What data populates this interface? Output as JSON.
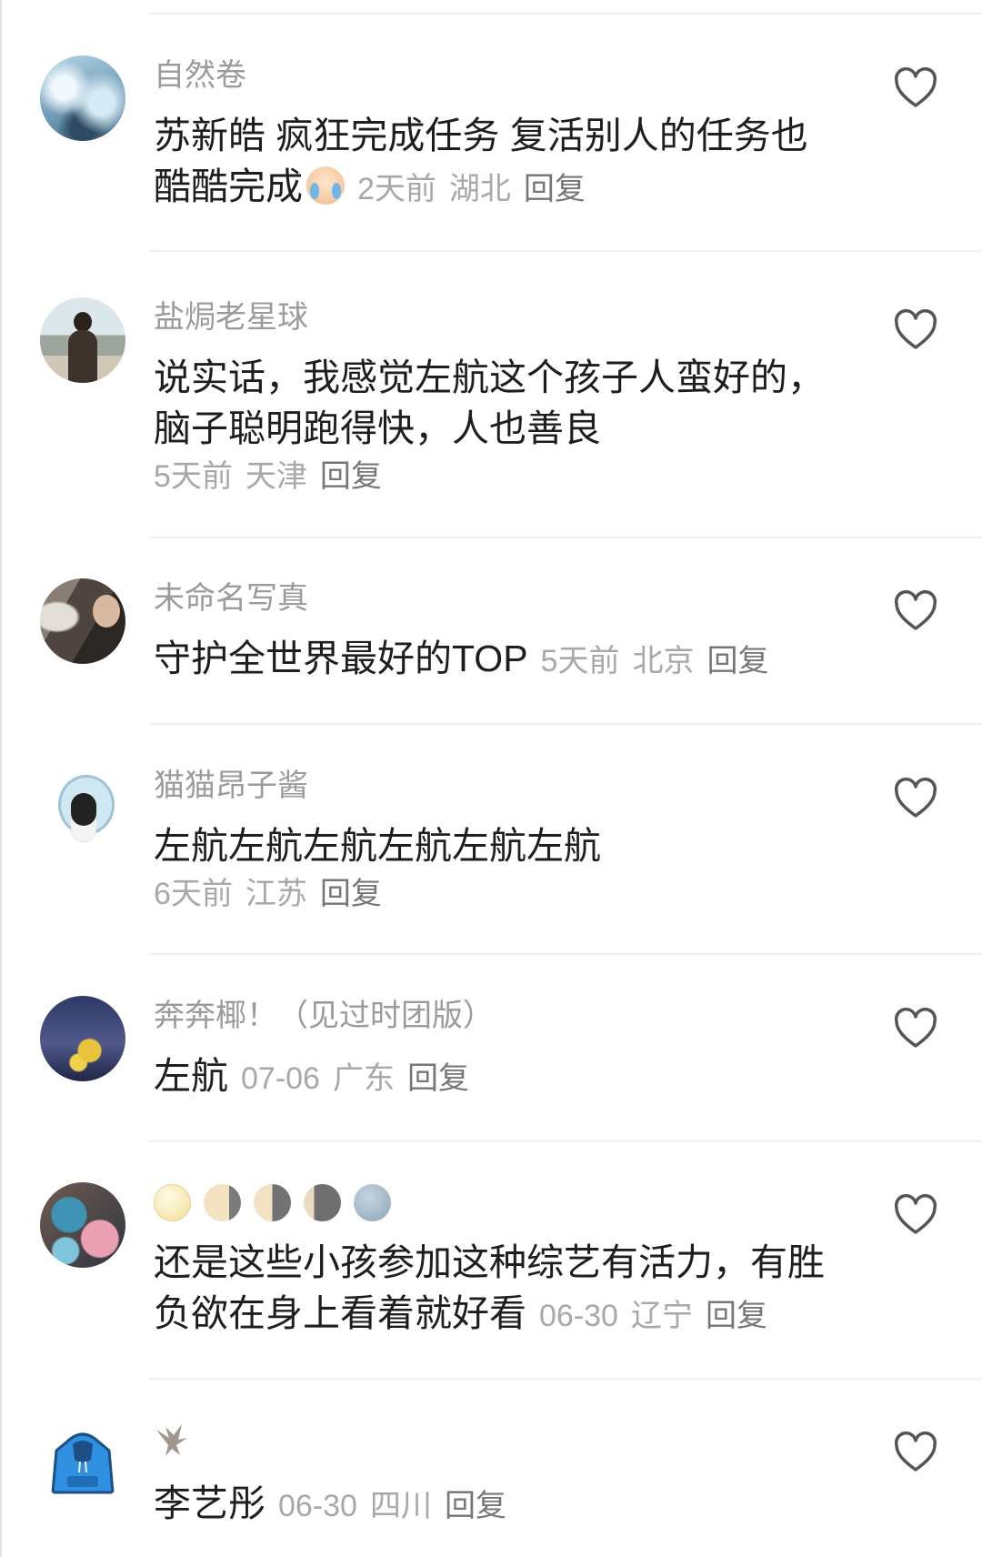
{
  "comments": [
    {
      "username": "自然卷",
      "avatar": "winter-trees-photo",
      "text_lines": [
        "苏新皓 疯狂完成任务 复活别人的任务也",
        "酷酷完成"
      ],
      "emoji": "crying-face",
      "meta": {
        "time": "2天前",
        "location": "湖北",
        "reply": "回复"
      }
    },
    {
      "username": "盐焗老星球",
      "avatar": "person-on-beach-photo",
      "text_lines": [
        "说实话，我感觉左航这个孩子人蛮好的，",
        "脑子聪明跑得快，人也善良"
      ],
      "meta": {
        "time": "5天前",
        "location": "天津",
        "reply": "回复"
      }
    },
    {
      "username": "未命名写真",
      "avatar": "selfie-photo",
      "text_lines": [
        "守护全世界最好的TOP"
      ],
      "meta": {
        "time": "5天前",
        "location": "北京",
        "reply": "回复"
      }
    },
    {
      "username": "猫猫昂子酱",
      "avatar": "penguin-cartoon",
      "text_lines": [
        "左航左航左航左航左航左航"
      ],
      "meta": {
        "time": "6天前",
        "location": "江苏",
        "reply": "回复"
      }
    },
    {
      "username": "奔奔椰！（见过时团版）",
      "avatar": "night-sky-figure-photo",
      "text_lines": [
        "左航"
      ],
      "meta": {
        "time": "07-06",
        "location": "广东",
        "reply": "回复"
      }
    },
    {
      "username_icons": [
        "full-moon-face",
        "waning-gibbous-moon",
        "last-quarter-moon",
        "waning-crescent-moon",
        "new-moon-face"
      ],
      "avatar": "two-people-photo",
      "text_lines": [
        "还是这些小孩参加这种综艺有活力，有胜",
        "负欲在身上看着就好看"
      ],
      "meta": {
        "time": "06-30",
        "location": "辽宁",
        "reply": "回复"
      }
    },
    {
      "username_icons": [
        "eagle"
      ],
      "avatar": "blue-hoodie-icon",
      "text_lines": [
        "李艺彤"
      ],
      "meta": {
        "time": "06-30",
        "location": "四川",
        "reply": "回复"
      }
    }
  ],
  "icons": {
    "like": "heart-outline-icon"
  }
}
